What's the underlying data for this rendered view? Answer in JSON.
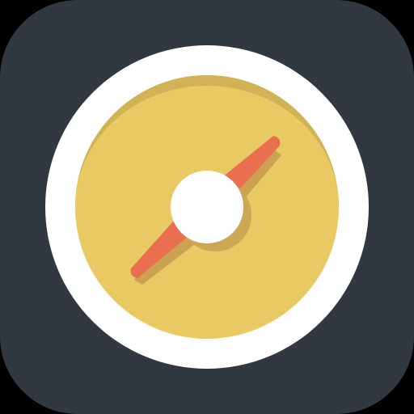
{
  "icon": {
    "name": "compass",
    "type": "app-icon"
  },
  "colors": {
    "background": "#313840",
    "ring": "#ffffff",
    "face": "#e9c964",
    "face_shadow": "#d2b257",
    "needle": "#e96f50",
    "needle_shadow": "#c79a4f",
    "center": "#ffffff",
    "center_shadow": "#cca856"
  }
}
